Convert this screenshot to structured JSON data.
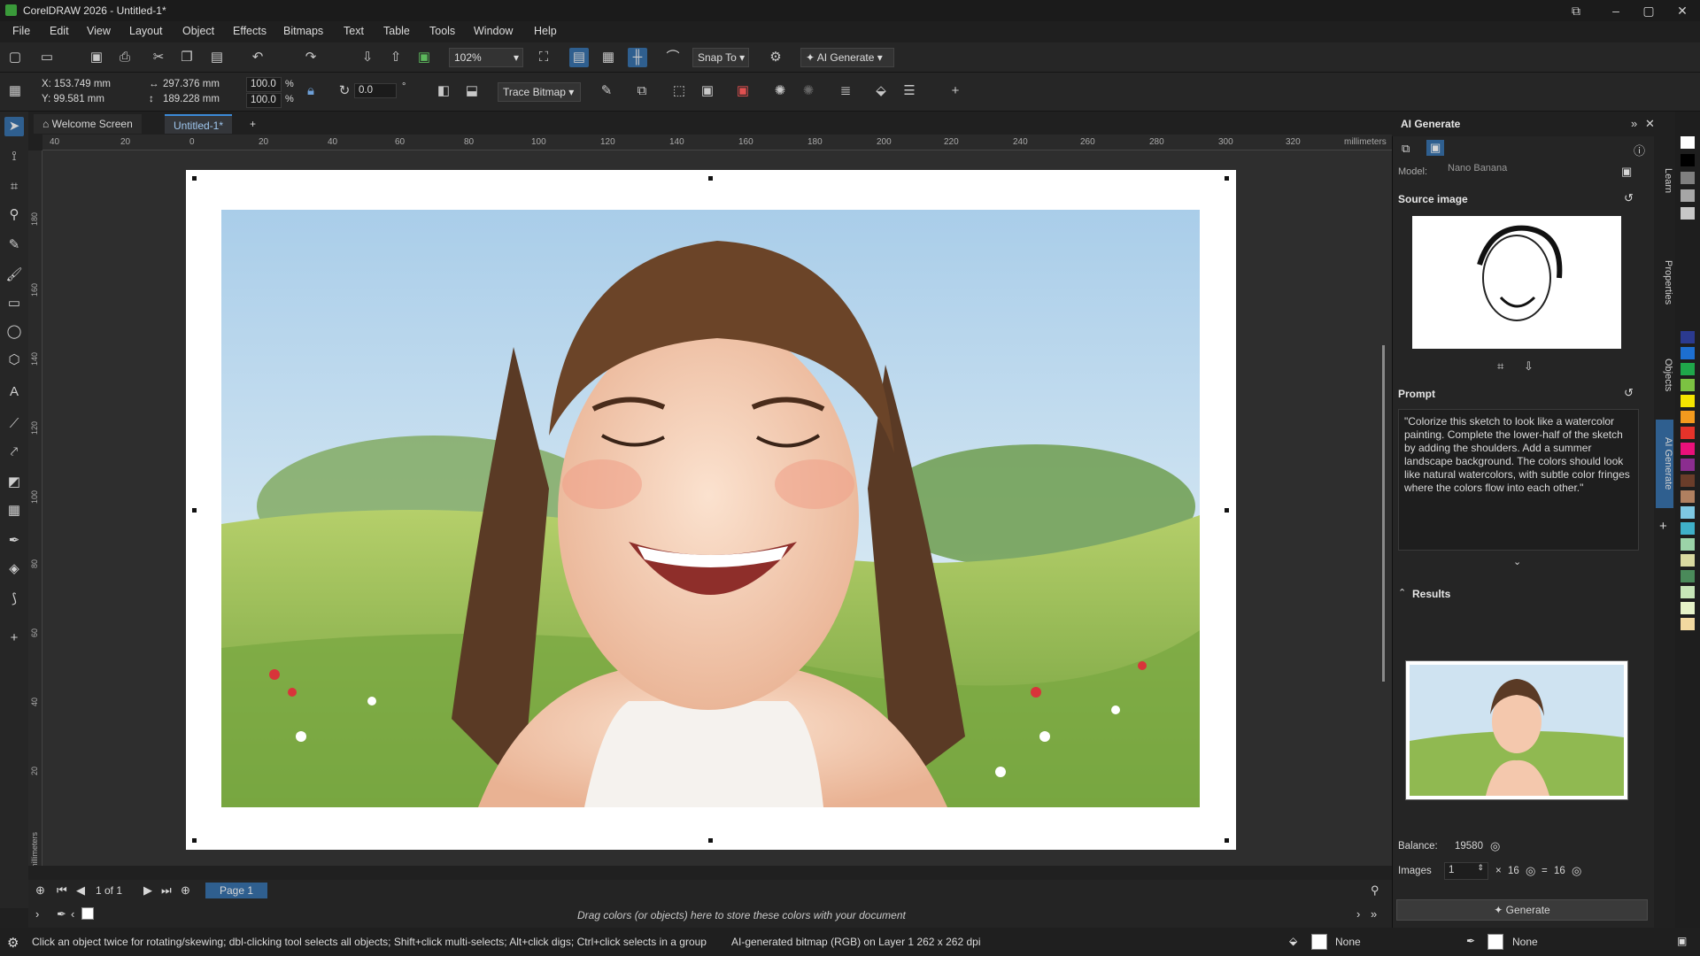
{
  "window": {
    "title": "CorelDRAW 2026 - Untitled-1*"
  },
  "menu": [
    "File",
    "Edit",
    "View",
    "Layout",
    "Object",
    "Effects",
    "Bitmaps",
    "Text",
    "Table",
    "Tools",
    "Window",
    "Help"
  ],
  "toolbar": {
    "zoom": "102%",
    "snap_to": "Snap To",
    "ai_generate": "AI Generate"
  },
  "props": {
    "x": "X: 153.749 mm",
    "y": "Y: 99.581 mm",
    "width": "297.376 mm",
    "height": "189.228 mm",
    "scale_x": "100.0",
    "scale_y": "100.0",
    "pct": "%",
    "rotation": "0.0",
    "deg": "°",
    "trace_bitmap": "Trace Bitmap"
  },
  "tabs": {
    "welcome": "Welcome Screen",
    "doc": "Untitled-1*"
  },
  "ruler": {
    "unit": "millimeters",
    "h_ticks": [
      "40",
      "20",
      "0",
      "20",
      "40",
      "60",
      "80",
      "100",
      "120",
      "140",
      "160",
      "180",
      "200",
      "220",
      "240",
      "260",
      "280",
      "300",
      "320"
    ],
    "v_ticks": [
      "180",
      "160",
      "140",
      "120",
      "100",
      "80",
      "60",
      "40",
      "20"
    ]
  },
  "pagenav": {
    "count": "1 of 1",
    "page": "Page 1"
  },
  "docpalette": {
    "hint": "Drag colors (or objects) here to store these colors with your document"
  },
  "status": {
    "hint": "Click an object twice for rotating/skewing; dbl-clicking tool selects all objects; Shift+click multi-selects; Alt+click digs; Ctrl+click selects in a group",
    "object": "AI-generated bitmap (RGB) on Layer 1  262 x 262 dpi",
    "fill": "None",
    "outline": "None"
  },
  "ai_panel": {
    "title": "AI Generate",
    "model_label": "Model:",
    "model_value": "Nano Banana",
    "source_image": "Source image",
    "prompt_label": "Prompt",
    "prompt_text": "\"Colorize this sketch to look like a watercolor painting. Complete the lower-half of the sketch by adding the shoulders. Add a summer landscape background. The colors should look like natural  watercolors, with subtle color fringes where the colors flow into each other.\"",
    "results": "Results",
    "balance_label": "Balance:",
    "balance_value": "19580",
    "images_label": "Images",
    "images_value": "1",
    "x": "×",
    "cost": "16",
    "eq": "=",
    "total": "16",
    "generate": "Generate"
  },
  "dock_tabs": [
    "Learn",
    "Properties",
    "Objects",
    "AI Generate"
  ],
  "palette_colors": [
    "#ffffff",
    "#000000",
    "#7f7f7f",
    "#a6a6a6",
    "#c8c8c8",
    "#2b3a8f",
    "#1d6fd1",
    "#1fa74a",
    "#7cc242",
    "#f5e400",
    "#f39a1e",
    "#e5332a",
    "#e8107a",
    "#8b2d8f",
    "#6a3d2a",
    "#b08060",
    "#7ec8e3",
    "#3fb0c8",
    "#9bd3a8",
    "#d9d9a0",
    "#4a8a5a",
    "#c7e6b8",
    "#e6f2c8",
    "#f2d9a0"
  ]
}
